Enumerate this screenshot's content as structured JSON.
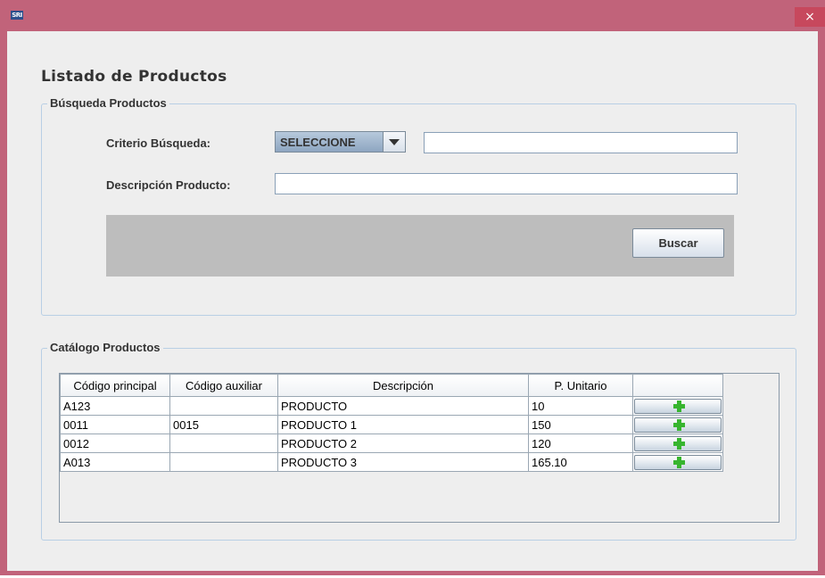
{
  "window": {
    "app_icon_text": "SRI",
    "close_glyph": "×"
  },
  "page": {
    "title": "Listado de Productos"
  },
  "search": {
    "group_title": "Búsqueda Productos",
    "criteria_label": "Criterio Búsqueda:",
    "criteria_selected": "SELECCIONE",
    "criteria_value": "",
    "description_label": "Descripción Producto:",
    "description_value": "",
    "search_button": "Buscar"
  },
  "catalog": {
    "group_title": "Catálogo Productos",
    "columns": [
      "Código principal",
      "Código auxiliar",
      "Descripción",
      "P. Unitario",
      ""
    ],
    "rows": [
      {
        "codigo_principal": "A123",
        "codigo_auxiliar": "",
        "descripcion": "PRODUCTO",
        "precio": "10",
        "action_icon": "plus-icon"
      },
      {
        "codigo_principal": "0011",
        "codigo_auxiliar": "0015",
        "descripcion": "PRODUCTO 1",
        "precio": "150",
        "action_icon": "plus-icon"
      },
      {
        "codigo_principal": "0012",
        "codigo_auxiliar": "",
        "descripcion": "PRODUCTO 2",
        "precio": "120",
        "action_icon": "plus-icon"
      },
      {
        "codigo_principal": "A013",
        "codigo_auxiliar": "",
        "descripcion": "PRODUCTO 3",
        "precio": "165.10",
        "action_icon": "plus-icon"
      }
    ]
  },
  "colors": {
    "title_bar": "#c1637a",
    "close_button": "#c7485d",
    "panel_background": "#eeeeee",
    "group_border": "#b8cfe5",
    "plus_icon": "#37b52f"
  }
}
